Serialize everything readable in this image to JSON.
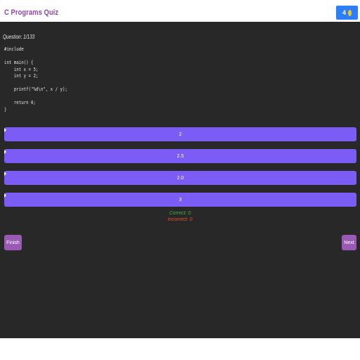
{
  "header": {
    "title": "C Programs Quiz",
    "coins": "4",
    "coin_icon": "coin-icon"
  },
  "question": {
    "counter": "Question: 1/133",
    "code": "#include\n\nint main() {\n    int x = 5;\n    int y = 2;\n\n    printf(\"%d\\n\", x / y);\n\n    return 0;\n}"
  },
  "options": [
    {
      "label": "2"
    },
    {
      "label": "2.5"
    },
    {
      "label": "2.0"
    },
    {
      "label": "3"
    }
  ],
  "stats": {
    "correct": "Correct: 0",
    "incorrect": "Incorrect: 0"
  },
  "buttons": {
    "finish": "Finish",
    "next": "Next"
  },
  "colors": {
    "title": "#8e44ad",
    "option": "#7b5cf4",
    "background": "#282828",
    "correct": "#43b047",
    "incorrect": "#e0502a",
    "button": "#9b59b6",
    "badge": "#2d7ff9"
  }
}
